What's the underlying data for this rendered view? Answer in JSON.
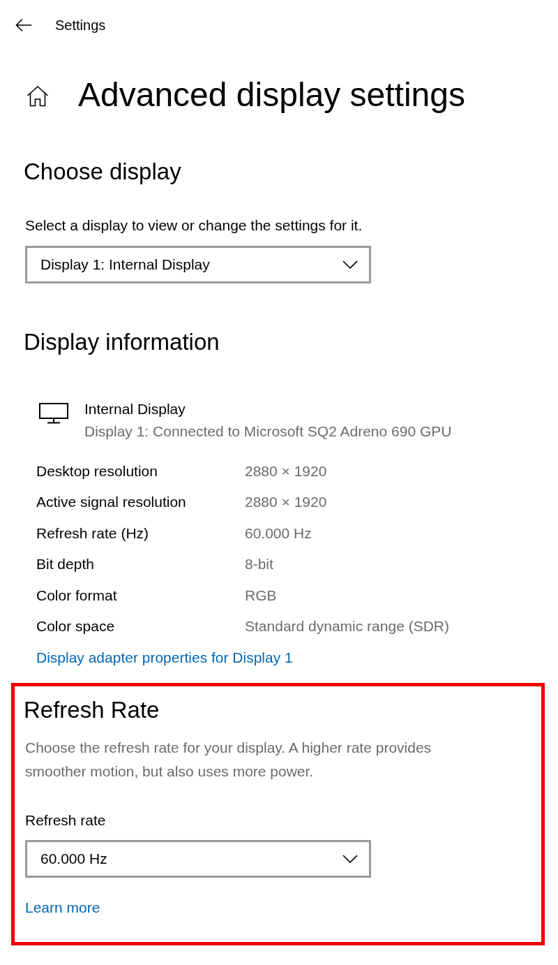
{
  "header": {
    "title": "Settings"
  },
  "page": {
    "title": "Advanced display settings"
  },
  "choose_display": {
    "heading": "Choose display",
    "label": "Select a display to view or change the settings for it.",
    "dropdown": {
      "value": "Display 1: Internal Display"
    }
  },
  "display_information": {
    "heading": "Display information",
    "display": {
      "name": "Internal Display",
      "description": "Display 1: Connected to Microsoft SQ2 Adreno 690 GPU"
    },
    "rows": [
      {
        "label": "Desktop resolution",
        "value": "2880 × 1920"
      },
      {
        "label": "Active signal resolution",
        "value": "2880 × 1920"
      },
      {
        "label": "Refresh rate (Hz)",
        "value": "60.000 Hz"
      },
      {
        "label": "Bit depth",
        "value": "8-bit"
      },
      {
        "label": "Color format",
        "value": "RGB"
      },
      {
        "label": "Color space",
        "value": "Standard dynamic range (SDR)"
      }
    ],
    "link": "Display adapter properties for Display 1"
  },
  "refresh_rate": {
    "highlighted": true,
    "heading": "Refresh Rate",
    "description": "Choose the refresh rate for your display. A higher rate provides smoother motion, but also uses more power.",
    "label": "Refresh rate",
    "dropdown": {
      "value": "60.000 Hz"
    },
    "link": "Learn more"
  }
}
